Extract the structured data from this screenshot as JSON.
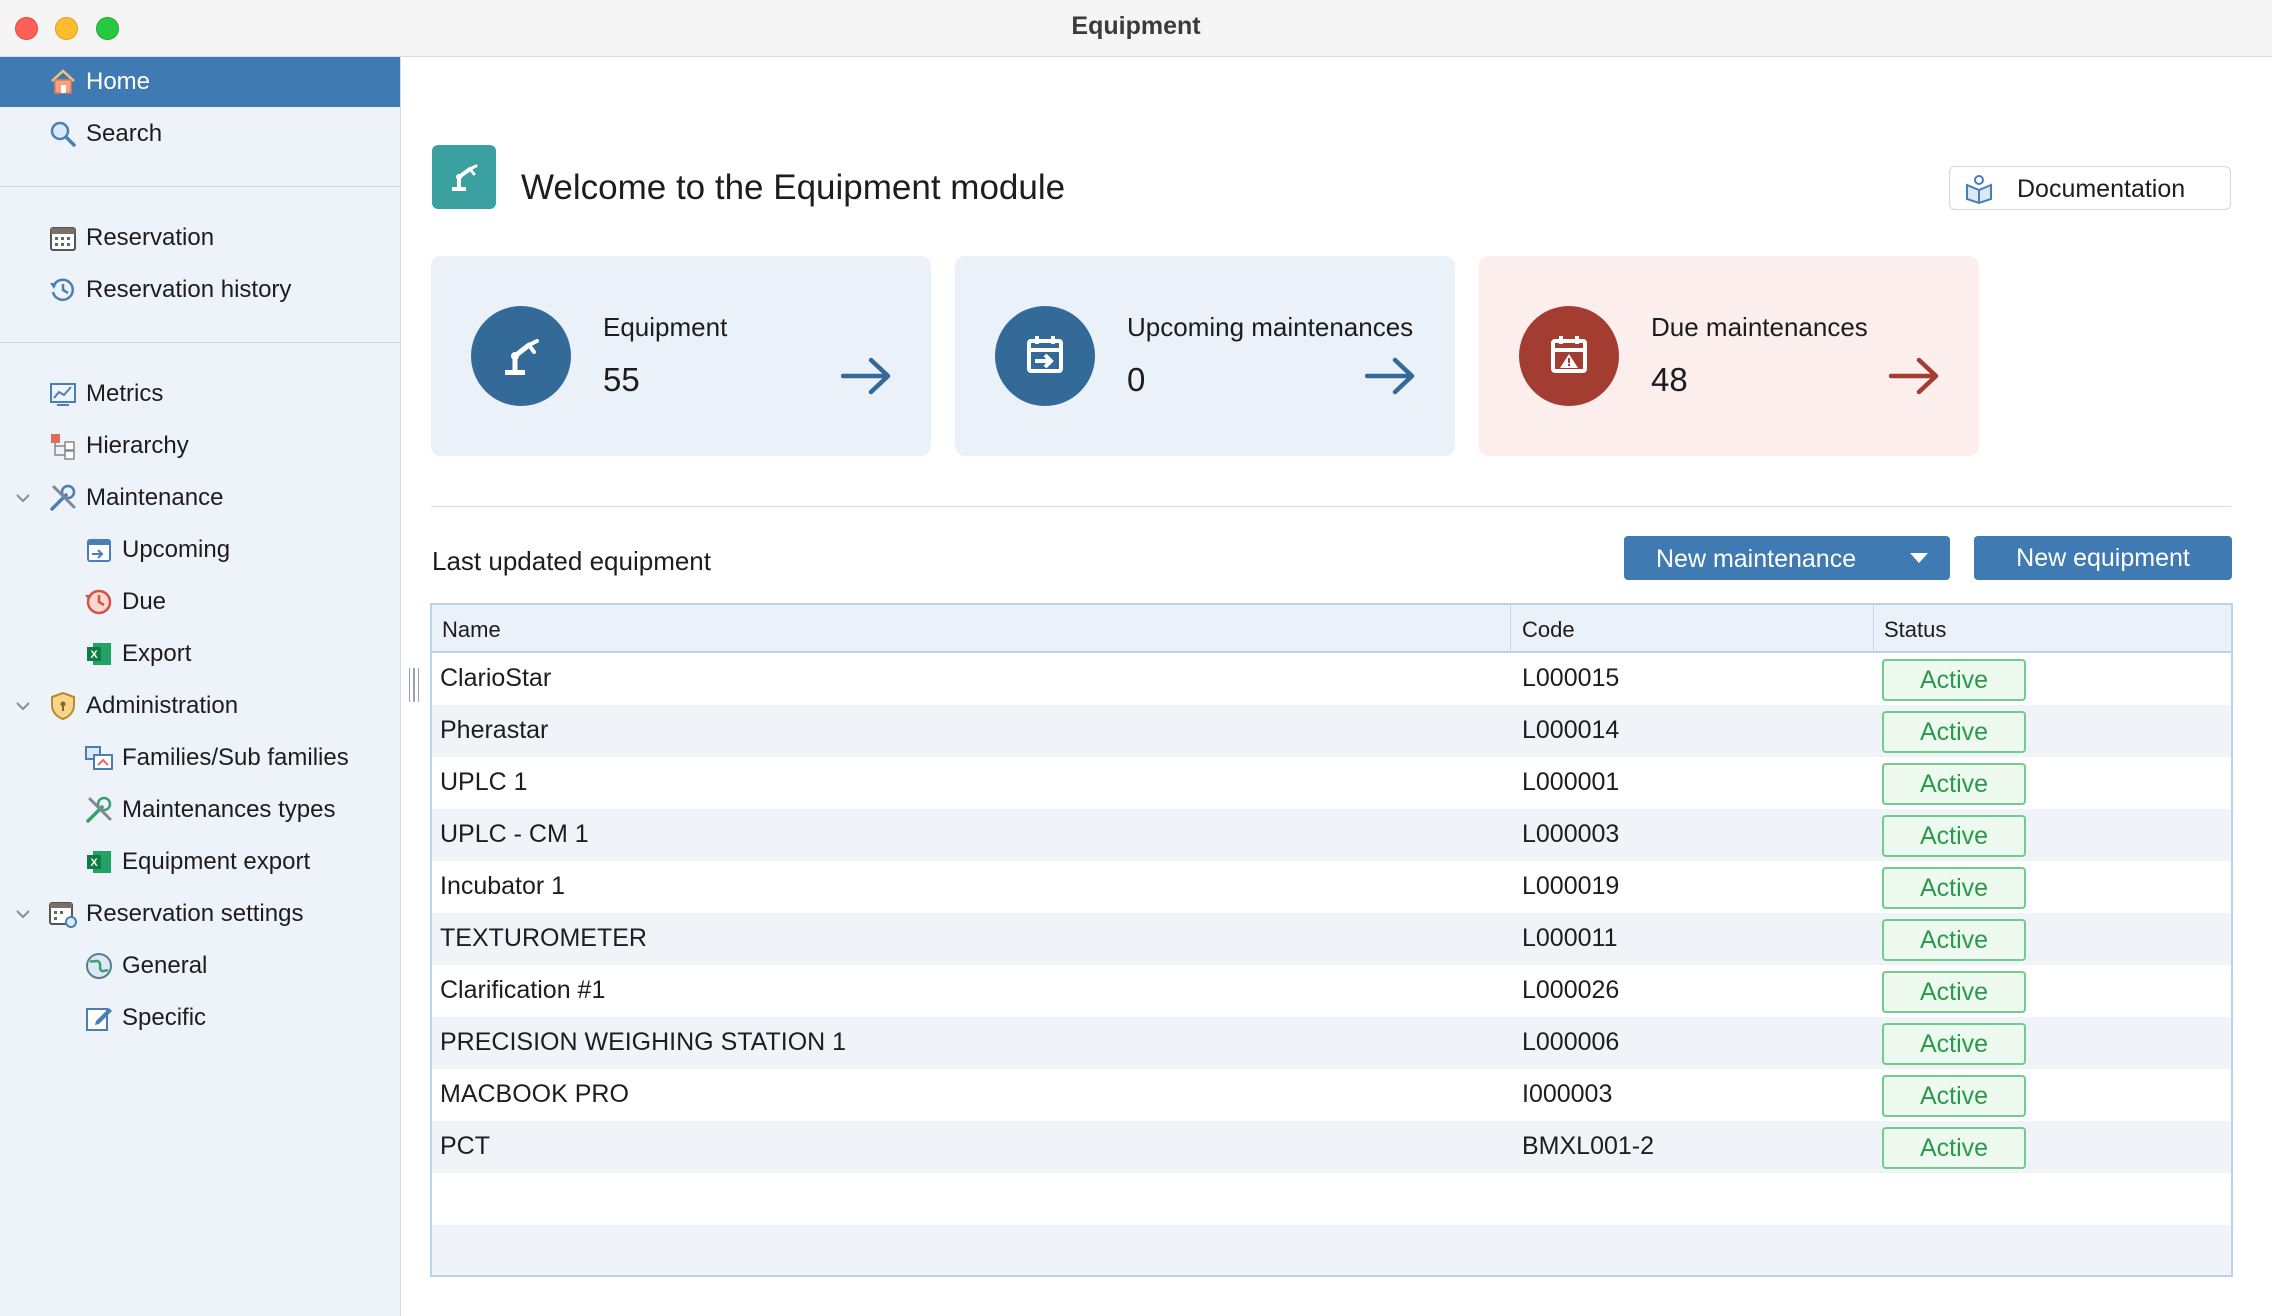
{
  "window": {
    "title": "Equipment"
  },
  "sidebar": {
    "items": [
      {
        "label": "Home",
        "icon": "home-icon"
      },
      {
        "label": "Search",
        "icon": "search-icon"
      },
      {
        "label": "Reservation",
        "icon": "calendar-icon"
      },
      {
        "label": "Reservation history",
        "icon": "history-icon"
      },
      {
        "label": "Metrics",
        "icon": "chart-icon"
      },
      {
        "label": "Hierarchy",
        "icon": "hierarchy-icon"
      },
      {
        "label": "Maintenance",
        "icon": "tools-icon"
      },
      {
        "label": "Upcoming",
        "icon": "calendar-arrow-icon"
      },
      {
        "label": "Due",
        "icon": "clock-alert-icon"
      },
      {
        "label": "Export",
        "icon": "excel-icon"
      },
      {
        "label": "Administration",
        "icon": "shield-icon"
      },
      {
        "label": "Families/Sub families",
        "icon": "families-icon"
      },
      {
        "label": "Maintenances types",
        "icon": "tools-icon"
      },
      {
        "label": "Equipment export",
        "icon": "excel-icon"
      },
      {
        "label": "Reservation settings",
        "icon": "calendar-gear-icon"
      },
      {
        "label": "General",
        "icon": "globe-icon"
      },
      {
        "label": "Specific",
        "icon": "edit-icon"
      }
    ]
  },
  "header": {
    "welcome": "Welcome to the Equipment module",
    "documentation_label": "Documentation"
  },
  "cards": [
    {
      "title": "Equipment",
      "value": "55",
      "icon": "robot-arm-icon"
    },
    {
      "title": "Upcoming maintenances",
      "value": "0",
      "icon": "calendar-arrow-icon"
    },
    {
      "title": "Due maintenances",
      "value": "48",
      "icon": "calendar-alert-icon"
    }
  ],
  "section": {
    "title": "Last updated equipment",
    "new_maintenance_label": "New maintenance",
    "new_equipment_label": "New equipment"
  },
  "table": {
    "columns": [
      "Name",
      "Code",
      "Status"
    ],
    "rows": [
      {
        "name": "ClarioStar",
        "code": "L000015",
        "status": "Active"
      },
      {
        "name": "Pherastar",
        "code": "L000014",
        "status": "Active"
      },
      {
        "name": "UPLC 1",
        "code": "L000001",
        "status": "Active"
      },
      {
        "name": "UPLC - CM 1",
        "code": "L000003",
        "status": "Active"
      },
      {
        "name": "Incubator 1",
        "code": "L000019",
        "status": "Active"
      },
      {
        "name": "TEXTUROMETER",
        "code": "L000011",
        "status": "Active"
      },
      {
        "name": "Clarification #1",
        "code": "L000026",
        "status": "Active"
      },
      {
        "name": "PRECISION WEIGHING STATION 1",
        "code": "L000006",
        "status": "Active"
      },
      {
        "name": "MACBOOK PRO",
        "code": "I000003",
        "status": "Active"
      },
      {
        "name": "PCT",
        "code": "BMXL001-2",
        "status": "Active"
      }
    ]
  },
  "colors": {
    "accent": "#3f7bb2",
    "card_blue_bg": "#eaf1f9",
    "card_red_bg": "#fbeeec",
    "card_blue_icon": "#346a98",
    "card_red_icon": "#a33d32",
    "status_green": "#2a9a4b"
  }
}
